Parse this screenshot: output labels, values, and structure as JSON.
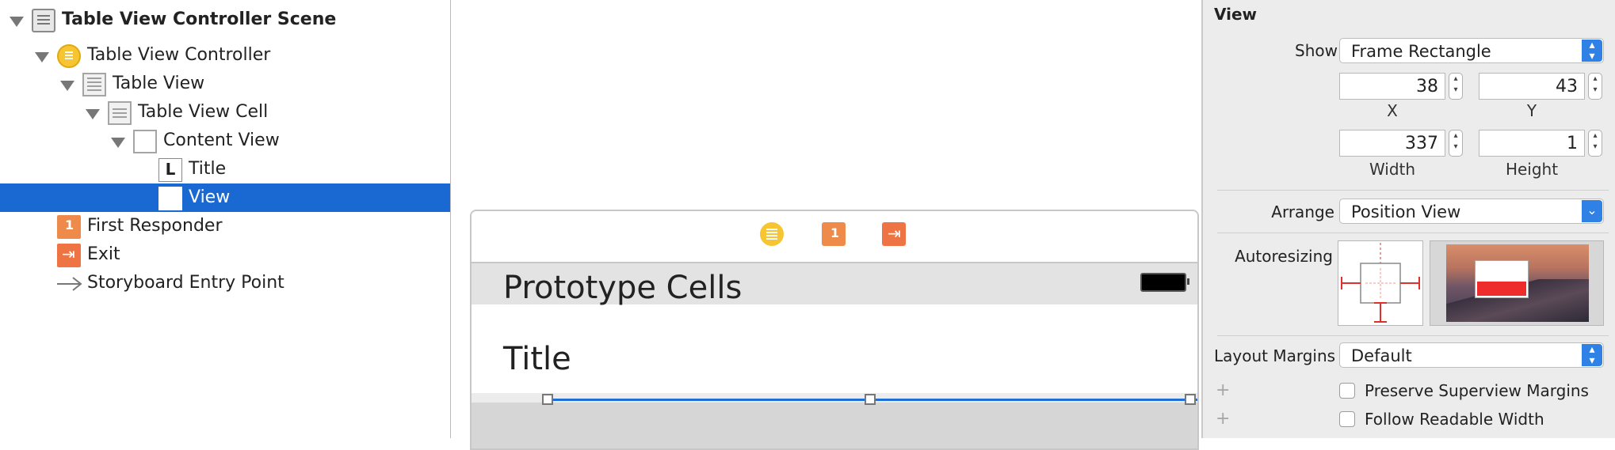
{
  "outline": {
    "items": [
      {
        "label": "Table View Controller Scene",
        "icon": "scene-icon"
      },
      {
        "label": "Table View Controller",
        "icon": "view-controller-icon"
      },
      {
        "label": "Table View",
        "icon": "table-view-icon"
      },
      {
        "label": "Table View Cell",
        "icon": "table-view-cell-icon"
      },
      {
        "label": "Content View",
        "icon": "view-icon"
      },
      {
        "label": "Title",
        "icon": "label-icon",
        "icon_glyph": "L"
      },
      {
        "label": "View",
        "icon": "view-icon",
        "selected": true
      },
      {
        "label": "First Responder",
        "icon": "first-responder-icon"
      },
      {
        "label": "Exit",
        "icon": "exit-icon"
      },
      {
        "label": "Storyboard Entry Point",
        "icon": "arrow-right-icon"
      }
    ]
  },
  "canvas": {
    "header_title": "Prototype Cells",
    "cell_title": "Title"
  },
  "inspector": {
    "section_title": "View",
    "show_label": "Show",
    "show_value": "Frame Rectangle",
    "x_value": "38",
    "y_value": "43",
    "width_value": "337",
    "height_value": "1",
    "x_label": "X",
    "y_label": "Y",
    "width_label": "Width",
    "height_label": "Height",
    "arrange_label": "Arrange",
    "arrange_value": "Position View",
    "autoresizing_label": "Autoresizing",
    "layout_margins_label": "Layout Margins",
    "layout_margins_value": "Default",
    "preserve_label": "Preserve Superview Margins",
    "readable_label": "Follow Readable Width"
  },
  "colors": {
    "selection": "#1a69d3",
    "popup_arrow": "#2f81e6",
    "autoresize_red": "#e0302c"
  }
}
